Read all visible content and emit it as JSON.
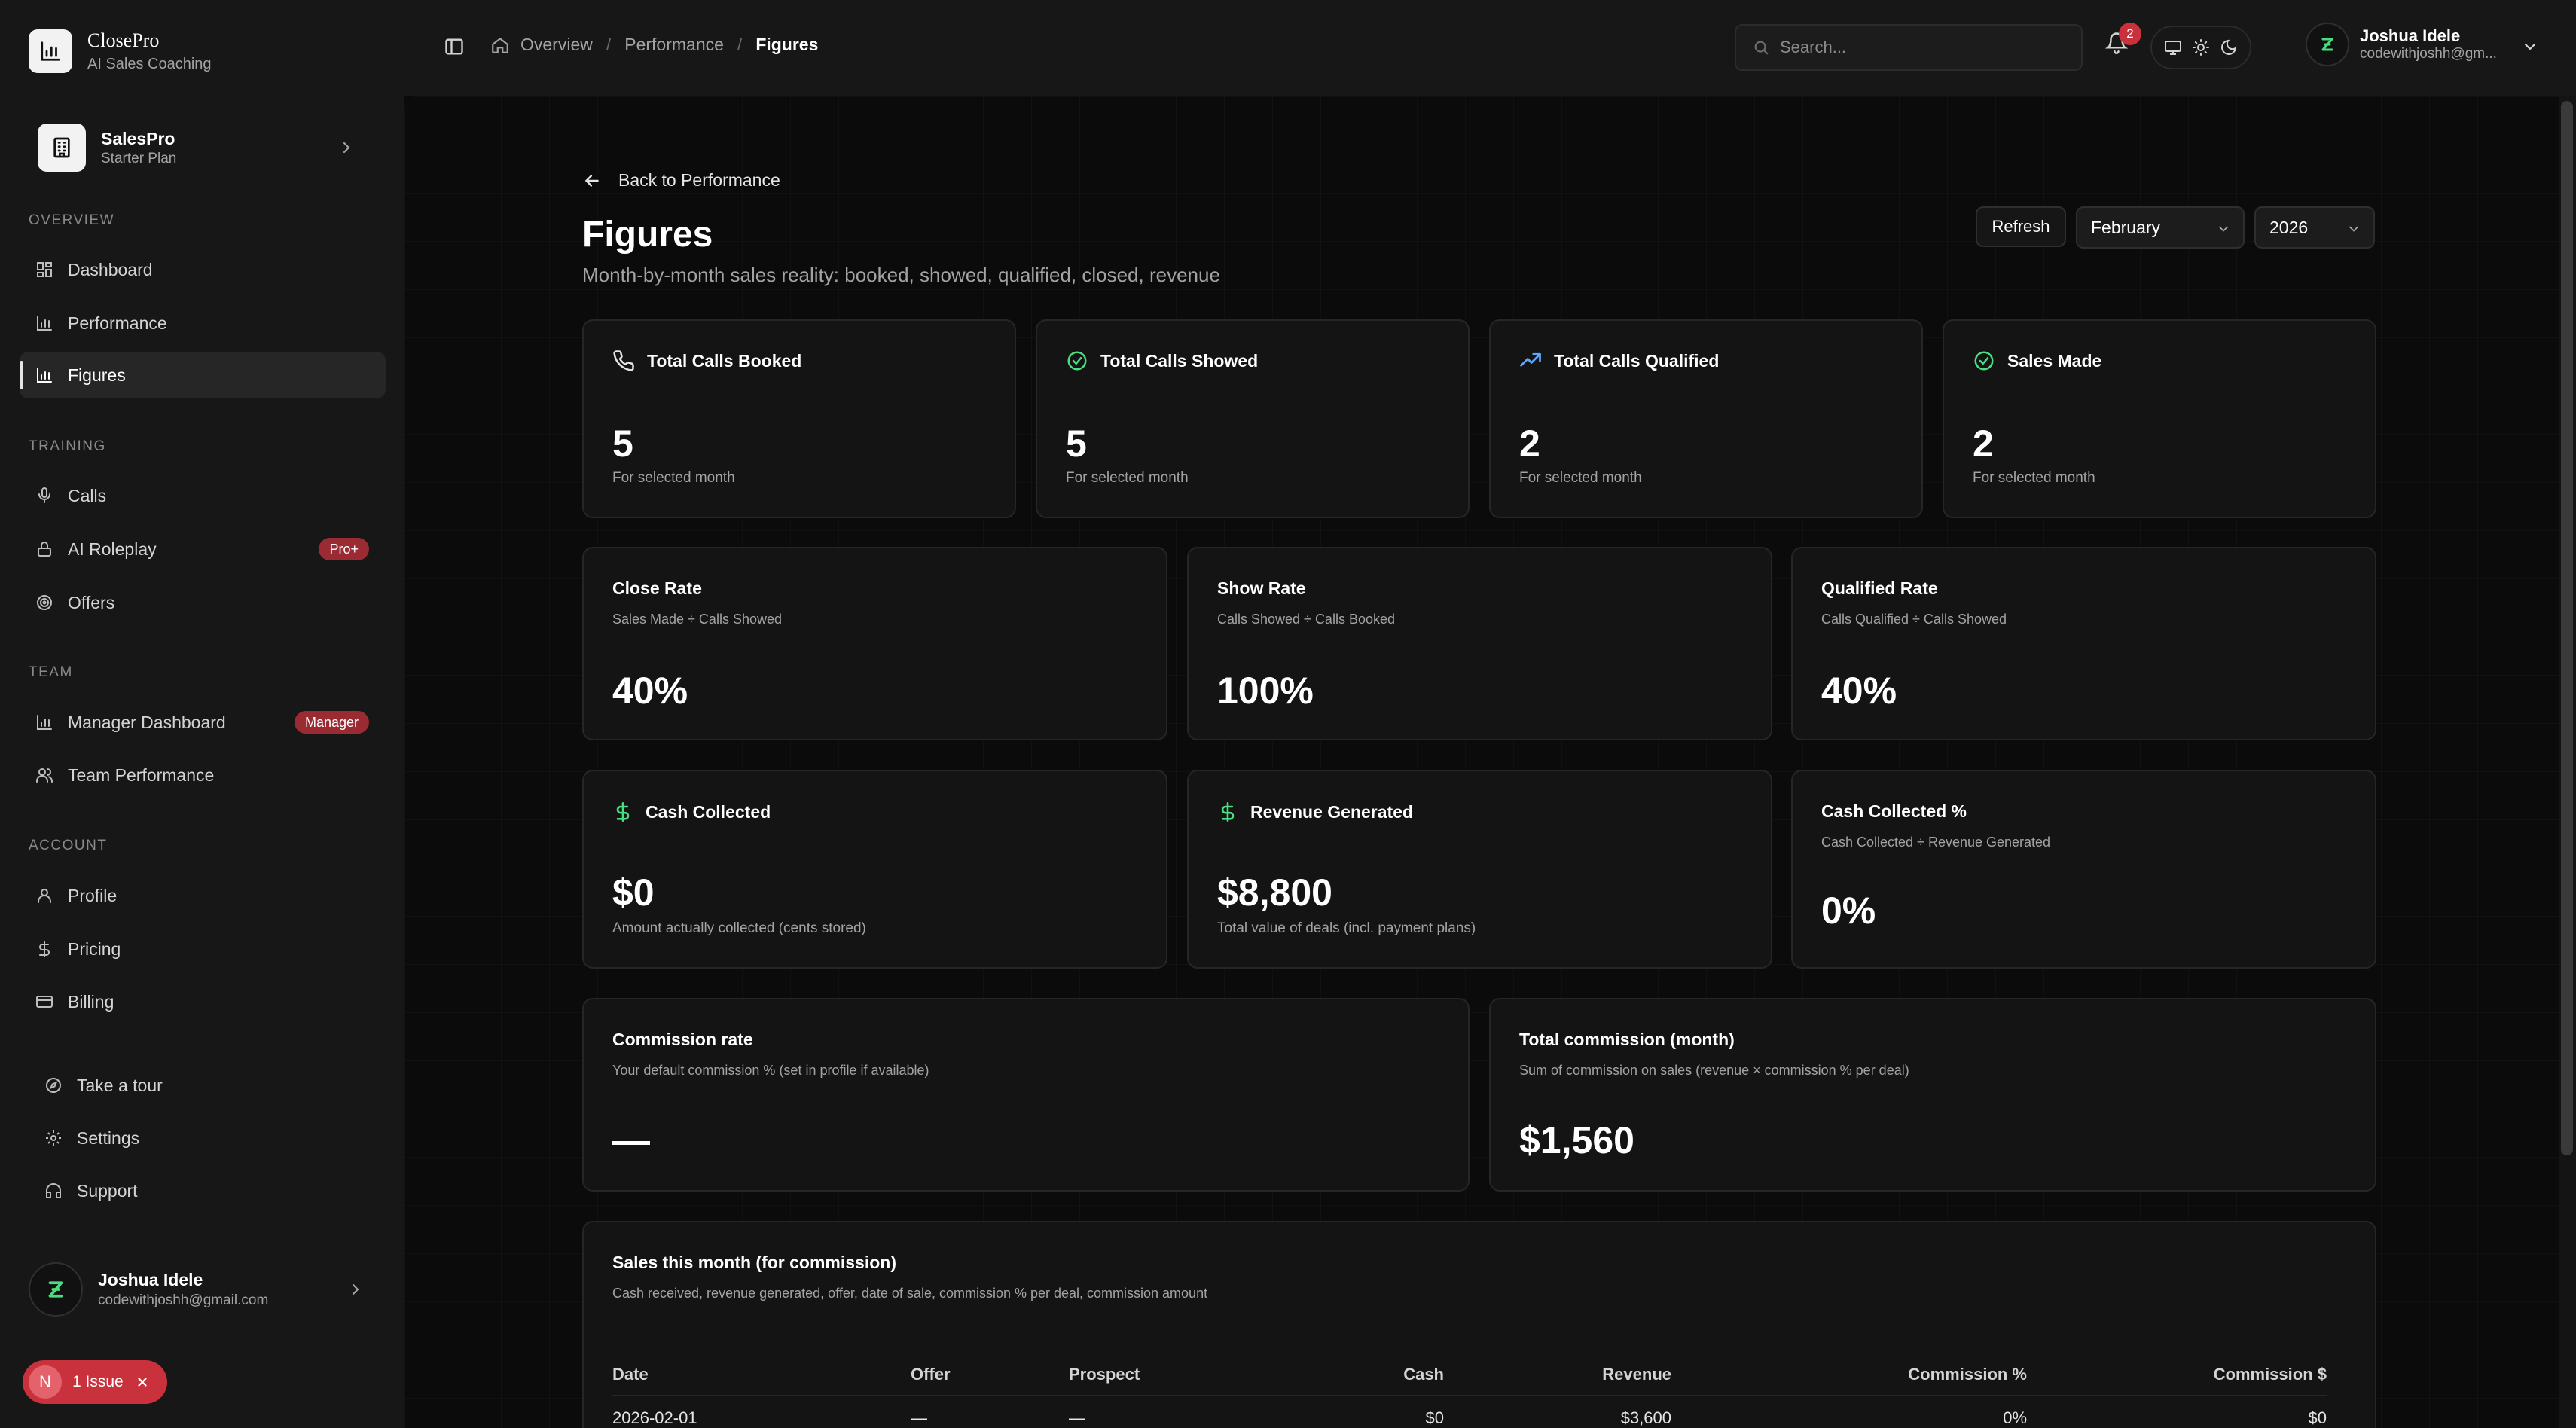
{
  "brand": {
    "name": "ClosePro",
    "subtitle": "AI Sales Coaching"
  },
  "org": {
    "name": "SalesPro",
    "plan": "Starter Plan"
  },
  "sidebar": {
    "sections": {
      "overview": "Overview",
      "training": "Training",
      "team": "Team",
      "account": "Account"
    },
    "items": {
      "dashboard": "Dashboard",
      "performance": "Performance",
      "figures": "Figures",
      "calls": "Calls",
      "ai_roleplay": "AI Roleplay",
      "ai_roleplay_badge": "Pro+",
      "offers": "Offers",
      "manager_dashboard": "Manager Dashboard",
      "manager_badge": "Manager",
      "team_performance": "Team Performance",
      "profile": "Profile",
      "pricing": "Pricing",
      "billing": "Billing",
      "take_tour": "Take a tour",
      "settings": "Settings",
      "support": "Support"
    },
    "user": {
      "name": "Joshua Idele",
      "email": "codewithjoshh@gmail.com"
    },
    "issue": {
      "n": "N",
      "label": "1 Issue"
    }
  },
  "topbar": {
    "breadcrumbs": [
      "Overview",
      "Performance",
      "Figures"
    ],
    "search_placeholder": "Search...",
    "notifications": "2",
    "user": {
      "name": "Joshua Idele",
      "email": "codewithjoshh@gm..."
    }
  },
  "page": {
    "back": "Back to Performance",
    "title": "Figures",
    "subtitle": "Month-by-month sales reality: booked, showed, qualified, closed, revenue",
    "refresh": "Refresh",
    "month": "February",
    "year": "2026"
  },
  "stats": {
    "booked": {
      "title": "Total Calls Booked",
      "value": "5",
      "note": "For selected month"
    },
    "showed": {
      "title": "Total Calls Showed",
      "value": "5",
      "note": "For selected month"
    },
    "qualified": {
      "title": "Total Calls Qualified",
      "value": "2",
      "note": "For selected month"
    },
    "sales": {
      "title": "Sales Made",
      "value": "2",
      "note": "For selected month"
    }
  },
  "rates": {
    "close": {
      "title": "Close Rate",
      "desc": "Sales Made ÷ Calls Showed",
      "value": "40%"
    },
    "show": {
      "title": "Show Rate",
      "desc": "Calls Showed ÷ Calls Booked",
      "value": "100%"
    },
    "qualified": {
      "title": "Qualified Rate",
      "desc": "Calls Qualified ÷ Calls Showed",
      "value": "40%"
    }
  },
  "money": {
    "cash": {
      "title": "Cash Collected",
      "value": "$0",
      "note": "Amount actually collected (cents stored)"
    },
    "revenue": {
      "title": "Revenue Generated",
      "value": "$8,800",
      "note": "Total value of deals (incl. payment plans)"
    },
    "cash_pct": {
      "title": "Cash Collected %",
      "desc": "Cash Collected ÷ Revenue Generated",
      "value": "0%"
    }
  },
  "commission": {
    "rate": {
      "title": "Commission rate",
      "desc": "Your default commission % (set in profile if available)",
      "value": "—"
    },
    "total": {
      "title": "Total commission (month)",
      "desc": "Sum of commission on sales (revenue × commission % per deal)",
      "value": "$1,560"
    }
  },
  "sales_table": {
    "title": "Sales this month (for commission)",
    "desc": "Cash received, revenue generated, offer, date of sale, commission % per deal, commission amount",
    "columns": [
      "Date",
      "Offer",
      "Prospect",
      "Cash",
      "Revenue",
      "Commission %",
      "Commission $"
    ],
    "rows": [
      [
        "2026-02-01",
        "—",
        "—",
        "$0",
        "$3,600",
        "0%",
        "$0"
      ]
    ]
  },
  "colors": {
    "accent_green": "#4ade80",
    "accent_blue": "#60a5fa",
    "badge_red": "#9a2b32",
    "issue_red": "#c9313d"
  }
}
